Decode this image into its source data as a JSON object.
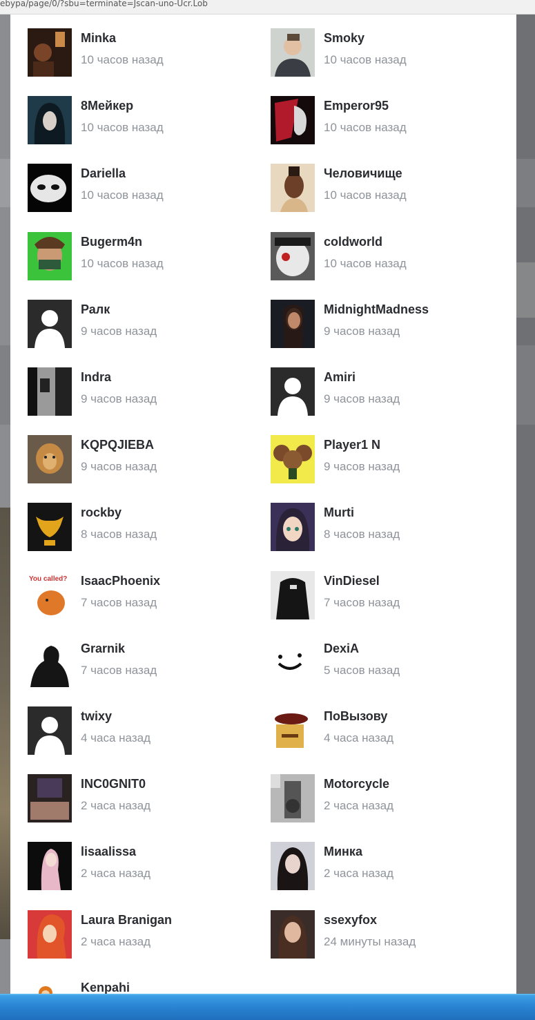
{
  "browser": {
    "url_fragment": "ebypa/page/0/?sbu=terminate=Jscan-uno-Ucr.Lob"
  },
  "background": {
    "colors": {
      "dim": "#8b8d91",
      "modal": "#ffffff",
      "taskbar": "#2b86d3"
    }
  },
  "activity_list": {
    "items": [
      {
        "name": "Minka",
        "time": "10 часов назад",
        "avatar": "dark-room-photo-avatar"
      },
      {
        "name": "Smoky",
        "time": "10 часов назад",
        "avatar": "man-portrait-avatar"
      },
      {
        "name": "8Мейкер",
        "time": "10 часов назад",
        "avatar": "hooded-girl-avatar"
      },
      {
        "name": "Emperor95",
        "time": "10 часов назад",
        "avatar": "red-mask-avatar"
      },
      {
        "name": "Dariella",
        "time": "10 часов назад",
        "avatar": "white-mask-avatar"
      },
      {
        "name": "Человичище",
        "time": "10 часов назад",
        "avatar": "woman-profile-avatar"
      },
      {
        "name": "Bugerm4n",
        "time": "10 часов назад",
        "avatar": "cartoon-character-avatar"
      },
      {
        "name": "coldworld",
        "time": "10 часов назад",
        "avatar": "anime-mask-avatar"
      },
      {
        "name": "Ралк",
        "time": "9 часов назад",
        "avatar": "default-user-avatar"
      },
      {
        "name": "MidnightMadness",
        "time": "9 часов назад",
        "avatar": "woman-dark-avatar"
      },
      {
        "name": "Indra",
        "time": "9 часов назад",
        "avatar": "bw-sketch-avatar"
      },
      {
        "name": "Amiri",
        "time": "9 часов назад",
        "avatar": "default-user-avatar"
      },
      {
        "name": "KQPQJIEBA",
        "time": "9 часов назад",
        "avatar": "lion-avatar"
      },
      {
        "name": "Player1 N",
        "time": "9 часов назад",
        "avatar": "cheburashka-avatar"
      },
      {
        "name": "rockby",
        "time": "8 часов назад",
        "avatar": "bull-logo-avatar"
      },
      {
        "name": "Murti",
        "time": "8 часов назад",
        "avatar": "anime-girl-avatar"
      },
      {
        "name": "IsaacPhoenix",
        "time": "7 часов назад",
        "avatar": "cartoon-fox-avatar"
      },
      {
        "name": "VinDiesel",
        "time": "7 часов назад",
        "avatar": "jacket-avatar"
      },
      {
        "name": "Grarnik",
        "time": "7 часов назад",
        "avatar": "silhouette-art-avatar"
      },
      {
        "name": "DexiA",
        "time": "5 часов назад",
        "avatar": "smiley-face-avatar"
      },
      {
        "name": "twixy",
        "time": "4 часа назад",
        "avatar": "default-user-avatar"
      },
      {
        "name": "ПоВызову",
        "time": "4 часа назад",
        "avatar": "cartoon-officer-avatar"
      },
      {
        "name": "INC0GNIT0",
        "time": "2 часа назад",
        "avatar": "bedroom-photo-avatar"
      },
      {
        "name": "Motorcycle",
        "time": "2 часа назад",
        "avatar": "grey-collage-avatar"
      },
      {
        "name": "lisaalissa",
        "time": "2 часа назад",
        "avatar": "pink-hair-avatar"
      },
      {
        "name": "Минка",
        "time": "2 часа назад",
        "avatar": "gothic-girl-avatar"
      },
      {
        "name": "Laura Branigan",
        "time": "2 часа назад",
        "avatar": "jessica-rabbit-avatar"
      },
      {
        "name": "ssexyfox",
        "time": "24 минуты назад",
        "avatar": "girl-portrait-avatar"
      },
      {
        "name": "Kenpahi",
        "time": "",
        "avatar": "orange-character-avatar"
      }
    ]
  }
}
